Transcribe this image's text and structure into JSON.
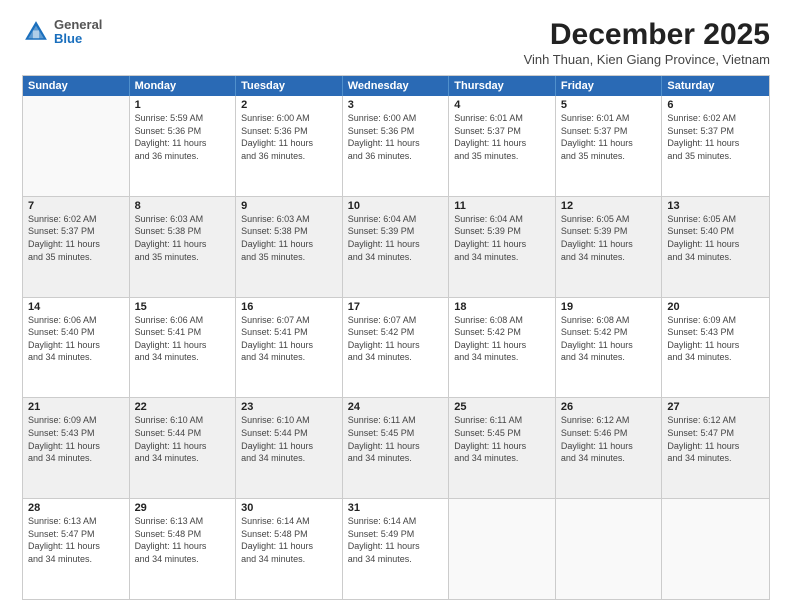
{
  "logo": {
    "general": "General",
    "blue": "Blue"
  },
  "title": "December 2025",
  "location": "Vinh Thuan, Kien Giang Province, Vietnam",
  "days": [
    "Sunday",
    "Monday",
    "Tuesday",
    "Wednesday",
    "Thursday",
    "Friday",
    "Saturday"
  ],
  "weeks": [
    [
      {
        "day": "",
        "info": ""
      },
      {
        "day": "1",
        "info": "Sunrise: 5:59 AM\nSunset: 5:36 PM\nDaylight: 11 hours\nand 36 minutes."
      },
      {
        "day": "2",
        "info": "Sunrise: 6:00 AM\nSunset: 5:36 PM\nDaylight: 11 hours\nand 36 minutes."
      },
      {
        "day": "3",
        "info": "Sunrise: 6:00 AM\nSunset: 5:36 PM\nDaylight: 11 hours\nand 36 minutes."
      },
      {
        "day": "4",
        "info": "Sunrise: 6:01 AM\nSunset: 5:37 PM\nDaylight: 11 hours\nand 35 minutes."
      },
      {
        "day": "5",
        "info": "Sunrise: 6:01 AM\nSunset: 5:37 PM\nDaylight: 11 hours\nand 35 minutes."
      },
      {
        "day": "6",
        "info": "Sunrise: 6:02 AM\nSunset: 5:37 PM\nDaylight: 11 hours\nand 35 minutes."
      }
    ],
    [
      {
        "day": "7",
        "info": "Sunrise: 6:02 AM\nSunset: 5:37 PM\nDaylight: 11 hours\nand 35 minutes."
      },
      {
        "day": "8",
        "info": "Sunrise: 6:03 AM\nSunset: 5:38 PM\nDaylight: 11 hours\nand 35 minutes."
      },
      {
        "day": "9",
        "info": "Sunrise: 6:03 AM\nSunset: 5:38 PM\nDaylight: 11 hours\nand 35 minutes."
      },
      {
        "day": "10",
        "info": "Sunrise: 6:04 AM\nSunset: 5:39 PM\nDaylight: 11 hours\nand 34 minutes."
      },
      {
        "day": "11",
        "info": "Sunrise: 6:04 AM\nSunset: 5:39 PM\nDaylight: 11 hours\nand 34 minutes."
      },
      {
        "day": "12",
        "info": "Sunrise: 6:05 AM\nSunset: 5:39 PM\nDaylight: 11 hours\nand 34 minutes."
      },
      {
        "day": "13",
        "info": "Sunrise: 6:05 AM\nSunset: 5:40 PM\nDaylight: 11 hours\nand 34 minutes."
      }
    ],
    [
      {
        "day": "14",
        "info": "Sunrise: 6:06 AM\nSunset: 5:40 PM\nDaylight: 11 hours\nand 34 minutes."
      },
      {
        "day": "15",
        "info": "Sunrise: 6:06 AM\nSunset: 5:41 PM\nDaylight: 11 hours\nand 34 minutes."
      },
      {
        "day": "16",
        "info": "Sunrise: 6:07 AM\nSunset: 5:41 PM\nDaylight: 11 hours\nand 34 minutes."
      },
      {
        "day": "17",
        "info": "Sunrise: 6:07 AM\nSunset: 5:42 PM\nDaylight: 11 hours\nand 34 minutes."
      },
      {
        "day": "18",
        "info": "Sunrise: 6:08 AM\nSunset: 5:42 PM\nDaylight: 11 hours\nand 34 minutes."
      },
      {
        "day": "19",
        "info": "Sunrise: 6:08 AM\nSunset: 5:42 PM\nDaylight: 11 hours\nand 34 minutes."
      },
      {
        "day": "20",
        "info": "Sunrise: 6:09 AM\nSunset: 5:43 PM\nDaylight: 11 hours\nand 34 minutes."
      }
    ],
    [
      {
        "day": "21",
        "info": "Sunrise: 6:09 AM\nSunset: 5:43 PM\nDaylight: 11 hours\nand 34 minutes."
      },
      {
        "day": "22",
        "info": "Sunrise: 6:10 AM\nSunset: 5:44 PM\nDaylight: 11 hours\nand 34 minutes."
      },
      {
        "day": "23",
        "info": "Sunrise: 6:10 AM\nSunset: 5:44 PM\nDaylight: 11 hours\nand 34 minutes."
      },
      {
        "day": "24",
        "info": "Sunrise: 6:11 AM\nSunset: 5:45 PM\nDaylight: 11 hours\nand 34 minutes."
      },
      {
        "day": "25",
        "info": "Sunrise: 6:11 AM\nSunset: 5:45 PM\nDaylight: 11 hours\nand 34 minutes."
      },
      {
        "day": "26",
        "info": "Sunrise: 6:12 AM\nSunset: 5:46 PM\nDaylight: 11 hours\nand 34 minutes."
      },
      {
        "day": "27",
        "info": "Sunrise: 6:12 AM\nSunset: 5:47 PM\nDaylight: 11 hours\nand 34 minutes."
      }
    ],
    [
      {
        "day": "28",
        "info": "Sunrise: 6:13 AM\nSunset: 5:47 PM\nDaylight: 11 hours\nand 34 minutes."
      },
      {
        "day": "29",
        "info": "Sunrise: 6:13 AM\nSunset: 5:48 PM\nDaylight: 11 hours\nand 34 minutes."
      },
      {
        "day": "30",
        "info": "Sunrise: 6:14 AM\nSunset: 5:48 PM\nDaylight: 11 hours\nand 34 minutes."
      },
      {
        "day": "31",
        "info": "Sunrise: 6:14 AM\nSunset: 5:49 PM\nDaylight: 11 hours\nand 34 minutes."
      },
      {
        "day": "",
        "info": ""
      },
      {
        "day": "",
        "info": ""
      },
      {
        "day": "",
        "info": ""
      }
    ]
  ]
}
